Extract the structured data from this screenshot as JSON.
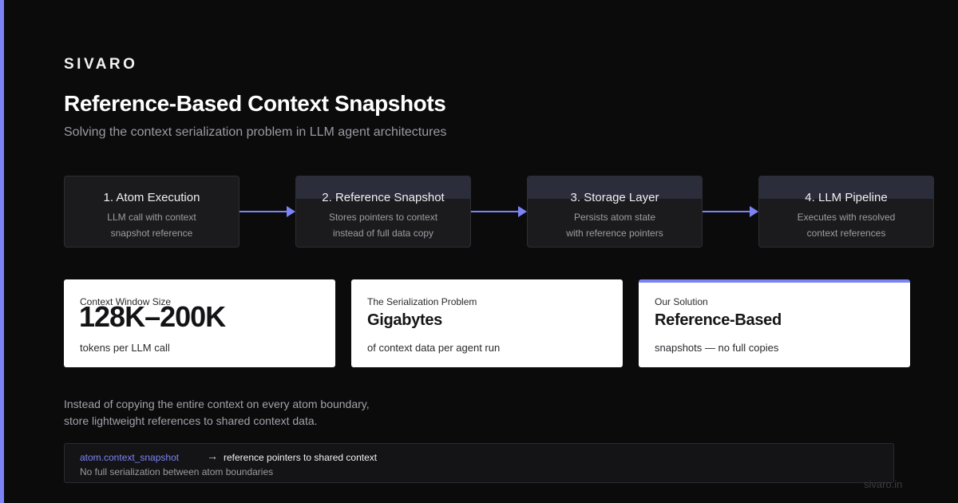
{
  "brand": "SIVARO",
  "title": "Reference-Based Context Snapshots",
  "subtitle": "Solving the context serialization problem in LLM agent architectures",
  "colors": {
    "background": "#0b0b0c",
    "accent": "#7c83f5",
    "card": "#ffffff",
    "step": "#1b1b1e"
  },
  "flow": {
    "steps": [
      {
        "title": "1. Atom Execution",
        "desc_line1": "LLM call with context",
        "desc_line2": "snapshot reference"
      },
      {
        "title": "2. Reference Snapshot",
        "desc_line1": "Stores pointers to context",
        "desc_line2": "instead of full data copy"
      },
      {
        "title": "3. Storage Layer",
        "desc_line1": "Persists atom state",
        "desc_line2": "with reference pointers"
      },
      {
        "title": "4. LLM Pipeline",
        "desc_line1": "Executes with resolved",
        "desc_line2": "context references"
      }
    ]
  },
  "cards": [
    {
      "label": "Context Window Size",
      "value": "128K–200K",
      "desc": "tokens per LLM call"
    },
    {
      "label": "The Serialization Problem",
      "value": "Gigabytes",
      "desc": "of context data per agent run"
    },
    {
      "label": "Our Solution",
      "value": "Reference-Based",
      "desc": "snapshots — no full copies"
    }
  ],
  "note": {
    "line1": "Instead of copying the entire context on every atom boundary,",
    "line2": "store lightweight references to shared context data."
  },
  "code": {
    "key": "atom.context_snapshot",
    "arrow": "→",
    "desc": "reference pointers to shared context",
    "note": "No full serialization between atom boundaries"
  },
  "footer_url": "sivaro.in"
}
